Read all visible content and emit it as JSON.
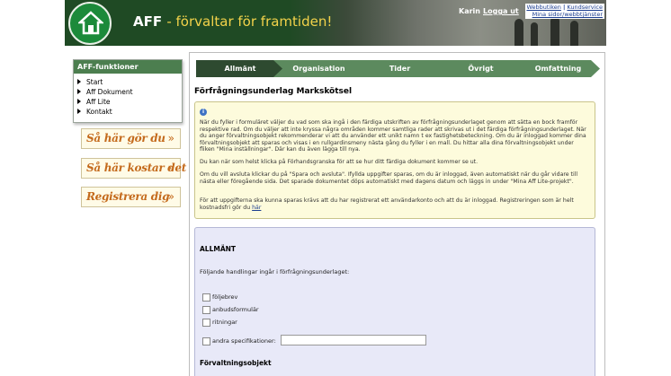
{
  "header": {
    "title": "AFF",
    "slogan": "- förvaltar för framtiden!",
    "user": "Karin",
    "logout": "Logga ut",
    "links": {
      "webbutiken": "Webbutiken",
      "separator": "|",
      "kundservice": "Kundservice",
      "mina_sidor": "Mina sidor/webbtjänster"
    }
  },
  "sidebar": {
    "title": "AFF-funktioner",
    "items": [
      {
        "label": "Start"
      },
      {
        "label": "Aff Dokument"
      },
      {
        "label": "Aff Lite"
      },
      {
        "label": "Kontakt"
      }
    ],
    "promos": [
      {
        "label": "Så här gör du"
      },
      {
        "label": "Så här kostar det"
      },
      {
        "label": "Registrera dig"
      }
    ]
  },
  "steps": [
    {
      "label": "Allmänt",
      "active": true
    },
    {
      "label": "Organisation",
      "active": false
    },
    {
      "label": "Tider",
      "active": false
    },
    {
      "label": "Övrigt",
      "active": false
    },
    {
      "label": "Omfattning",
      "active": false
    }
  ],
  "colors": {
    "step_active": "#2e4a30",
    "step_inactive": "#5c8a5e",
    "accent_green": "#1c8a3a",
    "promo_orange": "#c46a1c"
  },
  "page": {
    "title": "Förfrågningsunderlag Markskötsel"
  },
  "info": {
    "icon": "info-icon",
    "p1": "När du fyller i formuläret väljer du vad som ska ingå i den färdiga utskriften av förfrågningsunderlaget genom att sätta en bock framför respektive rad. Om du väljer att inte kryssa några områden kommer samtliga rader att skrivas ut i det färdiga förfrågningsunderlaget. När du anger förvaltningsobjekt rekommenderar vi att du använder ett unikt namn t ex fastighetsbeteckning. Om du är inloggad kommer dina förvaltningsobjekt att sparas och visas i en rullgardinsmeny nästa gång du fyller i en mall. Du hittar alla dina förvaltningsobjekt under fliken \"Mina inställningar\". Där kan du även lägga till nya.",
    "p2": "Du kan när som helst klicka på Förhandsgranska för att se hur ditt färdiga dokument kommer se ut.",
    "p3": "Om du vill avsluta klickar du på \"Spara och avsluta\". Ifyllda uppgifter sparas, om du är inloggad, även automatiskt när du går vidare till nästa eller föregående sida. Det sparade dokumentet döps automatiskt med dagens datum och läggs in under \"Mina Aff Lite-projekt\".",
    "p4": "För att uppgifterna ska kunna sparas krävs att du har registrerat ett användarkonto och att du är inloggad. Registreringen som är helt kostnadsfri gör du",
    "p4_link": "här"
  },
  "form": {
    "section": "ALLMÄNT",
    "lead": "Följande handlingar ingår i förfrågningsunderlaget:",
    "checkboxes": [
      {
        "label": "följebrev",
        "checked": false
      },
      {
        "label": "anbudsformulär",
        "checked": false
      },
      {
        "label": "ritningar",
        "checked": false
      },
      {
        "label": "andra specifikationer:",
        "checked": false
      }
    ],
    "other_value": "",
    "section2": "Förvaltningsobjekt"
  }
}
